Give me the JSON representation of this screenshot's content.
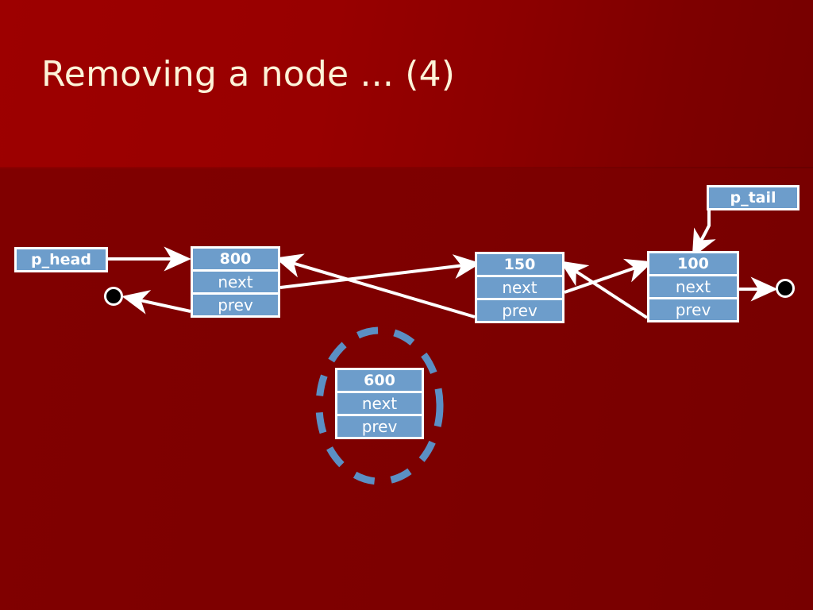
{
  "slide": {
    "title": "Removing a node ... (4)",
    "background_header_color": "#9d0000",
    "background_body_color": "#7a0000",
    "title_color": "#fdf3d8"
  },
  "palette": {
    "node_fill": "#6d9dcb",
    "node_border": "#ffffff",
    "arrow_color": "#ffffff",
    "highlight_ellipse": "#5b8fc4",
    "terminator_fill": "#000000"
  },
  "pointers": [
    {
      "id": "p_head",
      "label": "p_head"
    },
    {
      "id": "p_tail",
      "label": "p_tail"
    }
  ],
  "field_labels": {
    "next": "next",
    "prev": "prev"
  },
  "nodes": [
    {
      "id": "node-800",
      "address": "800",
      "next_label": "next",
      "prev_label": "prev",
      "removed": false
    },
    {
      "id": "node-150",
      "address": "150",
      "next_label": "next",
      "prev_label": "prev",
      "removed": false
    },
    {
      "id": "node-100",
      "address": "100",
      "next_label": "next",
      "prev_label": "prev",
      "removed": false
    },
    {
      "id": "node-600",
      "address": "600",
      "next_label": "next",
      "prev_label": "prev",
      "removed": true
    }
  ],
  "highlight": {
    "target_node": "600",
    "style": "dashed-ellipse",
    "color": "#5b8fc4"
  },
  "terminators": [
    {
      "id": "head-prev-null",
      "meaning": "null"
    },
    {
      "id": "tail-next-null",
      "meaning": "null"
    }
  ]
}
